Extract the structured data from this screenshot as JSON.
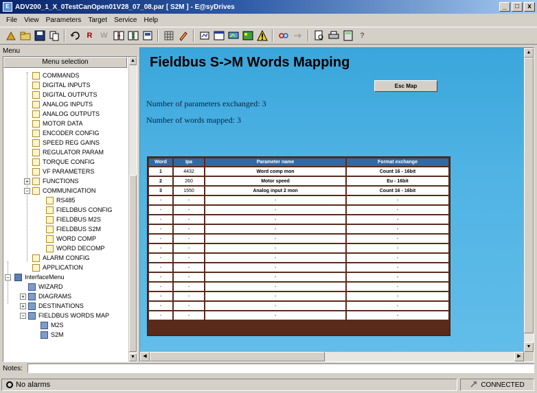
{
  "window": {
    "title": "ADV200_1_X_0TestCanOpen01V28_07_08.par [ S2M ] - E@syDrives",
    "minimize": "_",
    "maximize": "□",
    "close": "x"
  },
  "menubar": [
    "File",
    "View",
    "Parameters",
    "Target",
    "Service",
    "Help"
  ],
  "toolbar": {
    "icons": [
      "tools-icon",
      "open-icon",
      "save-icon",
      "copy-icon",
      "refresh-icon",
      "read-icon",
      "write-icon",
      "compare-icon",
      "compare2-icon",
      "settings-icon",
      "grid-icon",
      "edit-icon",
      "zoom-icon",
      "window-icon",
      "monitor-icon",
      "image-icon",
      "warning-icon",
      "link-icon",
      "sync-icon",
      "preview-icon",
      "print-icon",
      "calc-icon",
      "help-icon"
    ],
    "labels": {
      "read": "R",
      "write": "W",
      "help": "?"
    }
  },
  "left_panel": {
    "menu_label": "Menu",
    "header": "Menu selection",
    "items": [
      {
        "label": "COMMANDS",
        "icon": "page"
      },
      {
        "label": "DIGITAL INPUTS",
        "icon": "page"
      },
      {
        "label": "DIGITAL OUTPUTS",
        "icon": "page"
      },
      {
        "label": "ANALOG INPUTS",
        "icon": "page"
      },
      {
        "label": "ANALOG OUTPUTS",
        "icon": "page"
      },
      {
        "label": "MOTOR DATA",
        "icon": "page"
      },
      {
        "label": "ENCODER CONFIG",
        "icon": "page"
      },
      {
        "label": "SPEED REG GAINS",
        "icon": "page"
      },
      {
        "label": "REGULATOR PARAM",
        "icon": "page"
      },
      {
        "label": "TORQUE CONFIG",
        "icon": "page"
      },
      {
        "label": "VF PARAMETERS",
        "icon": "page"
      },
      {
        "label": "FUNCTIONS",
        "icon": "page"
      },
      {
        "label": "COMMUNICATION",
        "icon": "page"
      },
      {
        "label": "RS485",
        "icon": "page"
      },
      {
        "label": "FIELDBUS CONFIG",
        "icon": "page"
      },
      {
        "label": "FIELDBUS M2S",
        "icon": "page"
      },
      {
        "label": "FIELDBUS S2M",
        "icon": "page"
      },
      {
        "label": "WORD COMP",
        "icon": "page"
      },
      {
        "label": "WORD DECOMP",
        "icon": "page"
      },
      {
        "label": "ALARM CONFIG",
        "icon": "page"
      },
      {
        "label": "APPLICATION",
        "icon": "page"
      },
      {
        "label": "InterfaceMenu",
        "icon": "folder"
      },
      {
        "label": "WIZARD",
        "icon": "sub"
      },
      {
        "label": "DIAGRAMS",
        "icon": "sub"
      },
      {
        "label": "DESTINATIONS",
        "icon": "sub"
      },
      {
        "label": "FIELDBUS WORDS MAP",
        "icon": "sub"
      },
      {
        "label": "M2S",
        "icon": "sub"
      },
      {
        "label": "S2M",
        "icon": "sub"
      }
    ]
  },
  "main": {
    "title": "Fieldbus S->M Words Mapping",
    "esc_button": "Esc Map",
    "params_exchanged": "Number of parameters exchanged: 3",
    "words_mapped": "Number of words mapped: 3",
    "table": {
      "headers": [
        "Word",
        "Ipa",
        "Parameter name",
        "Format exchange"
      ],
      "rows": [
        [
          "1",
          "4432",
          "Word comp mon",
          "Count 16 - 16bit"
        ],
        [
          "2",
          "260",
          "Motor speed",
          "Eu - 16bit"
        ],
        [
          "3",
          "1550",
          "Analog input 2 mon",
          "Count 16 - 16bit"
        ],
        [
          "-",
          "-",
          "-",
          "-"
        ],
        [
          "-",
          "-",
          "-",
          "-"
        ],
        [
          "-",
          "-",
          "-",
          "-"
        ],
        [
          "-",
          "-",
          "-",
          "-"
        ],
        [
          "-",
          "-",
          "-",
          "-"
        ],
        [
          "-",
          "-",
          "-",
          "-"
        ],
        [
          "-",
          "-",
          "-",
          "-"
        ],
        [
          "-",
          "-",
          "-",
          "-"
        ],
        [
          "-",
          "-",
          "-",
          "-"
        ],
        [
          "-",
          "-",
          "-",
          "-"
        ],
        [
          "-",
          "-",
          "-",
          "-"
        ],
        [
          "-",
          "-",
          "-",
          "-"
        ],
        [
          "-",
          "-",
          "-",
          "-"
        ]
      ]
    }
  },
  "notes": {
    "label": "Notes:",
    "value": ""
  },
  "status": {
    "alarms": "No alarms",
    "connection": "CONNECTED"
  },
  "colors": {
    "content_bg": "#4fb3e4",
    "table_header": "#2f6aa8",
    "title_bar": "#0a246a"
  }
}
